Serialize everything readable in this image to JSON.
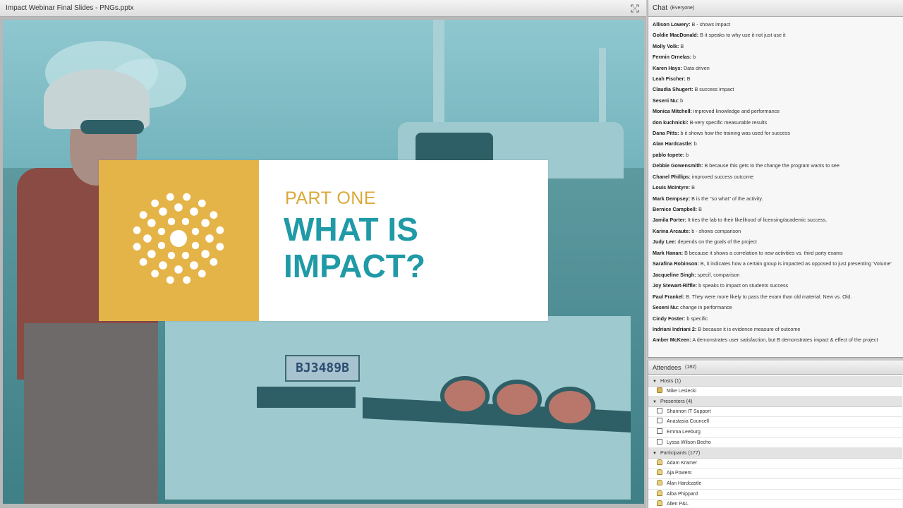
{
  "share_pod": {
    "title": "Impact Webinar Final Slides - PNGs.pptx"
  },
  "slide": {
    "kicker": "PART ONE",
    "title": "WHAT IS IMPACT?",
    "plate": "BJ3489B",
    "colors": {
      "card_accent": "#e5b449",
      "title_teal": "#1f9aa6",
      "kicker_gold": "#d9a938"
    }
  },
  "chat": {
    "title": "Chat",
    "scope": "(Everyone)",
    "messages": [
      {
        "name": "Allison Lowery:",
        "text": "B - shows impact"
      },
      {
        "name": "Goldie MacDonald:",
        "text": "B it speaks to why use it not just use it"
      },
      {
        "name": "Molly Volk:",
        "text": "B"
      },
      {
        "name": "Fermin Ornelas:",
        "text": "b"
      },
      {
        "name": "Karen Hays:",
        "text": "Data driven"
      },
      {
        "name": "Leah Fischer:",
        "text": "B"
      },
      {
        "name": "Claudia Shugert:",
        "text": "B success impact"
      },
      {
        "name": "Seseni Nu:",
        "text": "b"
      },
      {
        "name": "Monica Mitchell:",
        "text": "improved knowledge and performance"
      },
      {
        "name": "don kuchnicki:",
        "text": "B-very specific measurable results"
      },
      {
        "name": "Dana Pitts:",
        "text": "b it shows how the training was used for success"
      },
      {
        "name": "Alan Hardcastle:",
        "text": "b"
      },
      {
        "name": "pablo topete:",
        "text": "b"
      },
      {
        "name": "Debbie Gowensmith:",
        "text": "B because this gets to the change the program wants to see"
      },
      {
        "name": "Chanel Phillips:",
        "text": "improved success outcome"
      },
      {
        "name": "Louis McIntyre:",
        "text": "B"
      },
      {
        "name": "Mark Dempsey:",
        "text": "B is the \"so what\" of the activity."
      },
      {
        "name": "Bernice Campbell:",
        "text": "B"
      },
      {
        "name": "Jamila Porter:",
        "text": "It ties the lab to their likelihood of licensing/academic success."
      },
      {
        "name": "Karina Arcaute:",
        "text": "b - shows comparison"
      },
      {
        "name": "Judy Lee:",
        "text": "depends on the goals of the project"
      },
      {
        "name": "Mark Hanan:",
        "text": "B because it shows a correlation to new activities vs. third party exams"
      },
      {
        "name": "Sarafina Robinson:",
        "text": "B, it indicates how a certain group is impacted as opposed to just presenting 'Volume'"
      },
      {
        "name": "Jacqueline Singh:",
        "text": "specif, comparison"
      },
      {
        "name": "Joy Stewart-Riffle:",
        "text": "b speaks to impact on students success"
      },
      {
        "name": "Paul Frankel:",
        "text": "B. They were more likely to pass the exam than old material. New vs. Old."
      },
      {
        "name": "Seseni Nu:",
        "text": " change in performance"
      },
      {
        "name": "Cindy Foster:",
        "text": "b specific"
      },
      {
        "name": "Indriani  Indriani  2:",
        "text": "B because it is evidence measure of outcome"
      },
      {
        "name": "Amber McKeen:",
        "text": "A demonstrates user satisfaction, but B demonstrates impact & effect of the project"
      }
    ]
  },
  "attendees": {
    "title": "Attendees",
    "count": "(182)",
    "groups": [
      {
        "label": "Hosts (1)",
        "role": "host",
        "members": [
          "Mike Lesiecki"
        ]
      },
      {
        "label": "Presenters (4)",
        "role": "presenter",
        "members": [
          "Shannon IT Support",
          "Anastasia Councell",
          "Emma Leeburg",
          "Lyssa  Wilson Becho"
        ]
      },
      {
        "label": "Participants (177)",
        "role": "participant",
        "members": [
          "Adam Kramer",
          "Aja Powers",
          "Alan Hardcastle",
          "Alba Phippard",
          "Allen P&L"
        ]
      }
    ]
  }
}
